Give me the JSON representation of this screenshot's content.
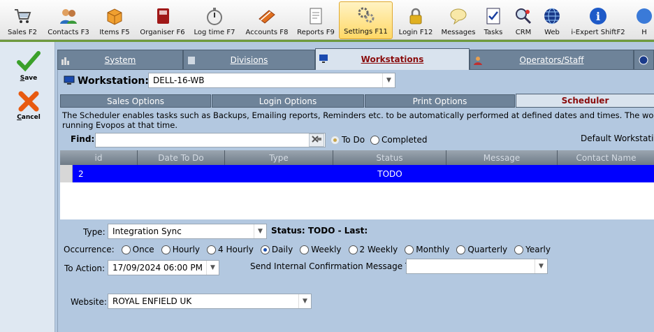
{
  "toolbar": {
    "buttons": [
      {
        "label": "Sales F2",
        "icon": "cart-icon"
      },
      {
        "label": "Contacts F3",
        "icon": "people-icon"
      },
      {
        "label": "Items F5",
        "icon": "box-icon"
      },
      {
        "label": "Organiser F6",
        "icon": "organiser-book-icon"
      },
      {
        "label": "Log time F7",
        "icon": "stopwatch-icon"
      },
      {
        "label": "Accounts F8",
        "icon": "ledger-book-icon"
      },
      {
        "label": "Reports F9",
        "icon": "report-icon"
      },
      {
        "label": "Settings F11",
        "icon": "gears-icon"
      },
      {
        "label": "Login F12",
        "icon": "padlock-icon"
      },
      {
        "label": "Messages",
        "icon": "speech-bubble-icon"
      },
      {
        "label": "Tasks",
        "icon": "checklist-icon"
      },
      {
        "label": "CRM",
        "icon": "magnifier-person-icon"
      },
      {
        "label": "Web",
        "icon": "globe-icon"
      },
      {
        "label": "i-Expert ShiftF2",
        "icon": "info-icon"
      },
      {
        "label": "H",
        "icon": "help-icon"
      }
    ],
    "active": "Settings F11"
  },
  "leftbar": {
    "save_label": "Save",
    "save_u": "S",
    "save_rest": "ave",
    "cancel_u": "C",
    "cancel_rest": "ancel"
  },
  "tabs": {
    "system": "System",
    "divisions": "Divisions",
    "workstations": "Workstations",
    "operators": "Operators/Staff"
  },
  "workstation": {
    "label": "Workstation:",
    "value": "DELL-16-WB"
  },
  "subtabs": {
    "sales": "Sales Options",
    "login": "Login Options",
    "print": "Print Options",
    "scheduler": "Scheduler"
  },
  "description": {
    "line1": "The Scheduler enables tasks such as Backups, Emailing reports, Reminders etc. to be automatically performed at defined dates and times.  The  workstation",
    "line2": "running Evopos at that time."
  },
  "find": {
    "label": "Find:",
    "value": "",
    "todo_label": "To Do",
    "completed_label": "Completed",
    "default_ws": "Default Workstation"
  },
  "grid": {
    "columns": [
      "id",
      "Date To Do",
      "Type",
      "Status",
      "Message",
      "Contact Name"
    ],
    "rows": [
      {
        "id": "2",
        "date": "",
        "type": "",
        "status": "TODO",
        "message": "",
        "contact": ""
      }
    ]
  },
  "form": {
    "type_label": "Type:",
    "type_value": "Integration Sync",
    "status_text": "Status: TODO - Last:",
    "occurrence_label": "Occurrence:",
    "occurrence_options": [
      "Once",
      "Hourly",
      "4 Hourly",
      "Daily",
      "Weekly",
      "2 Weekly",
      "Monthly",
      "Quarterly",
      "Yearly"
    ],
    "occurrence_selected": "Daily",
    "to_action_label": "To Action:",
    "to_action_value": "17/09/2024 06:00 PM",
    "send_label": "Send Internal Confirmation Message To:",
    "send_value": "",
    "website_label": "Website:",
    "website_value": "ROYAL ENFIELD UK"
  },
  "colors": {
    "selected_row": "#0000ff",
    "active_tab_text": "#8a0c0c",
    "panel_bg": "#b3c8e0",
    "tab_bg": "#6e8399"
  }
}
